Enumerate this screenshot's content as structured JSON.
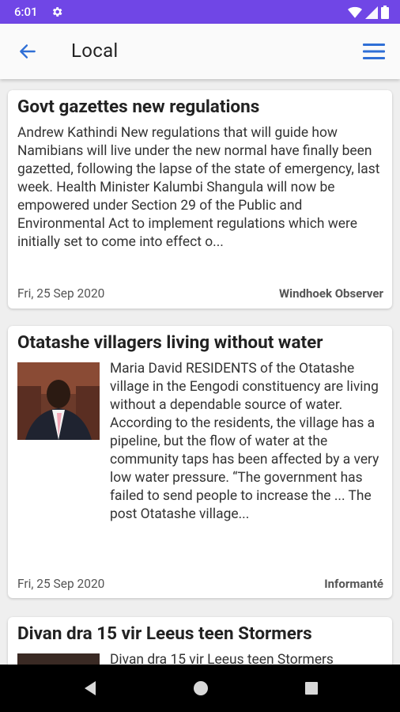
{
  "status_bar": {
    "time": "6:01",
    "icons": [
      "gear-icon",
      "wifi-icon",
      "cellular-signal-icon",
      "battery-icon"
    ]
  },
  "app_bar": {
    "title": "Local",
    "icons": [
      "back-arrow-icon",
      "hamburger-menu-icon"
    ]
  },
  "articles": [
    {
      "title": "Govt gazettes new regulations",
      "snippet": "Andrew Kathindi New regulations that will guide how Namibians will live under the new normal have finally been gazetted, following the lapse of the state of emergency, last week. Health Minister Kalumbi Shangula will now be empowered under Section 29 of the Public and Environmental Act to implement regulations which were initially set to come into effect o...",
      "date": "Fri, 25 Sep 2020",
      "source": "Windhoek Observer",
      "has_image": false
    },
    {
      "title": "Otatashe villagers living without water",
      "snippet": "Maria David RESIDENTS of the Otatashe village in the Eengodi constituency are living without a dependable source of water. According to the residents, the village has a pipeline, but the flow of water at the community taps has been affected by a very low water pressure. “The government has failed to send people to increase the ... The post Otatashe village...",
      "date": "Fri, 25 Sep 2020",
      "source": "Informanté",
      "has_image": true
    },
    {
      "title": "Divan dra 15 vir Leeus teen Stormers",
      "snippet": "Divan dra 15 vir Leeus teen Stormers",
      "has_image": true
    }
  ],
  "colors": {
    "status_bar": "#7046e6",
    "accent": "#2f6fd6",
    "background": "#efefef"
  },
  "nav_bar": {
    "icons": [
      "back-triangle-icon",
      "home-circle-icon",
      "recents-square-icon"
    ]
  }
}
